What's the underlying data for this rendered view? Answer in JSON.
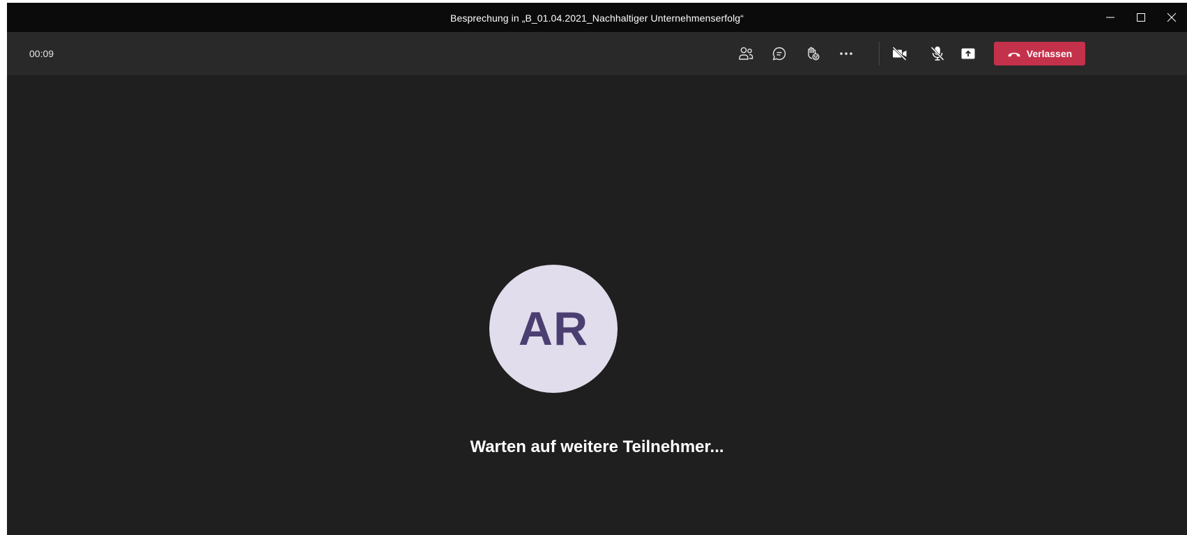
{
  "window": {
    "title": "Besprechung in „B_01.04.2021_Nachhaltiger Unternehmenserfolg“",
    "controls": [
      "minimize-icon",
      "maximize-icon",
      "close-icon"
    ]
  },
  "toolbar": {
    "timer": "00:09",
    "icons": [
      "participants-icon",
      "chat-icon",
      "reactions-icon",
      "more-options-icon",
      "camera-off-icon",
      "mic-off-icon",
      "share-screen-icon"
    ],
    "leave_label": "Verlassen",
    "leave_color": "#c4314b"
  },
  "stage": {
    "avatar_initials": "AR",
    "avatar_bg": "#e2ddec",
    "avatar_fg": "#4b3f72",
    "waiting_text": "Warten auf weitere Teilnehmer..."
  }
}
